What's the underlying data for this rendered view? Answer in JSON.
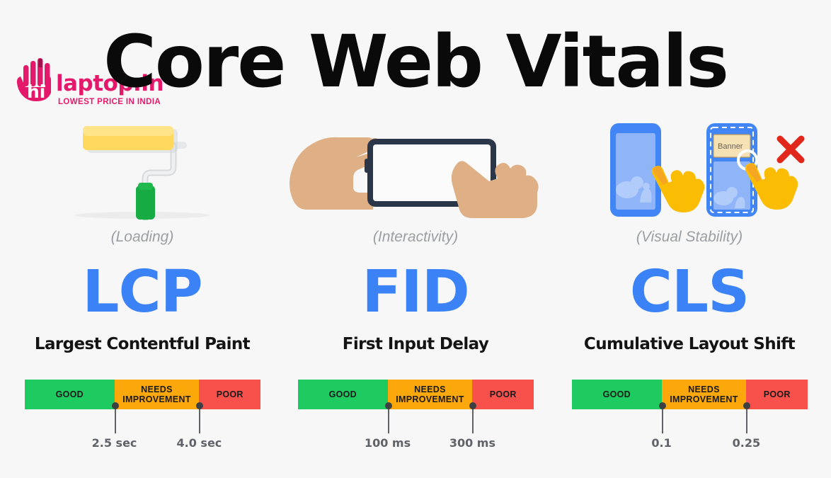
{
  "page": {
    "title": "Core Web Vitals",
    "background_color": "#f7f7f7"
  },
  "logo": {
    "wordmark": "laptop.in",
    "hand_text": "hi",
    "tagline": "LOWEST PRICE IN INDIA",
    "color": "#e5196b"
  },
  "colors": {
    "accent_blue": "#3b82f6",
    "good": "#1ecb60",
    "needs_improvement": "#fca80a",
    "poor": "#f8514c",
    "muted_gray": "#9b9fa3",
    "tick_gray": "#5f6368"
  },
  "legend": {
    "good": "GOOD",
    "needs_improvement_line1": "NEEDS",
    "needs_improvement_line2": "IMPROVEMENT",
    "poor": "POOR"
  },
  "metrics": [
    {
      "id": "lcp",
      "category": "(Loading)",
      "acronym": "LCP",
      "fullname": "Largest Contentful Paint",
      "icon": "paint-roller-icon",
      "thresholds": {
        "good_end_pct": 38,
        "ni_end_pct": 74,
        "good_label": "2.5 sec",
        "ni_label": "4.0 sec"
      }
    },
    {
      "id": "fid",
      "category": "(Interactivity)",
      "acronym": "FID",
      "fullname": "First Input Delay",
      "icon": "hands-tapping-phone-icon",
      "thresholds": {
        "good_end_pct": 38,
        "ni_end_pct": 74,
        "good_label": "100 ms",
        "ni_label": "300 ms"
      }
    },
    {
      "id": "cls",
      "category": "(Visual Stability)",
      "acronym": "CLS",
      "fullname": "Cumulative Layout Shift",
      "icon": "layout-shift-phones-icon",
      "thresholds": {
        "good_end_pct": 38,
        "ni_end_pct": 74,
        "good_label": "0.1",
        "ni_label": "0.25"
      }
    }
  ],
  "illustrations": {
    "cls_banner_label": "Banner"
  }
}
